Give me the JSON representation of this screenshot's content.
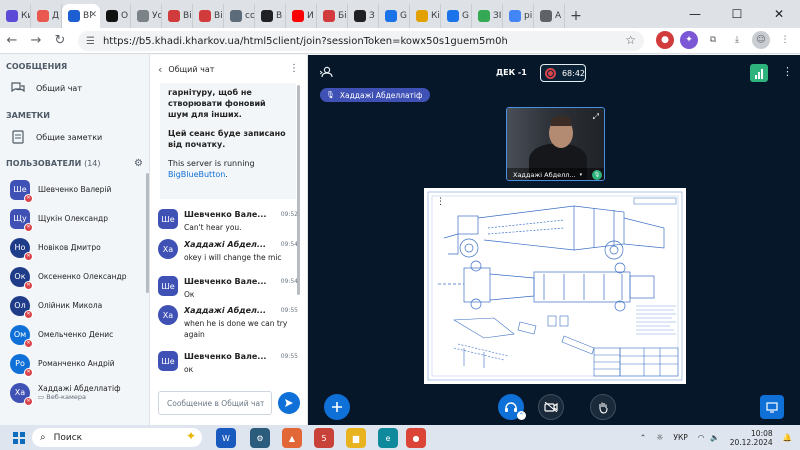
{
  "browser": {
    "tabs": [
      {
        "label": "Ки",
        "color": "#5b4bd6"
      },
      {
        "label": "Д",
        "color": "#e9584f"
      },
      {
        "label": "Bl",
        "color": "#1d5fd0",
        "active": true
      },
      {
        "label": "О",
        "color": "#111111"
      },
      {
        "label": "Ус",
        "color": "#7b8288"
      },
      {
        "label": "Bi",
        "color": "#d23b3b"
      },
      {
        "label": "Bi",
        "color": "#d23b3b"
      },
      {
        "label": "со",
        "color": "#5b6b7a"
      },
      {
        "label": "В",
        "color": "#202124"
      },
      {
        "label": "И",
        "color": "#ff0000"
      },
      {
        "label": "Бі",
        "color": "#d23b3b"
      },
      {
        "label": "З",
        "color": "#202124"
      },
      {
        "label": "G",
        "color": "#1a73e8"
      },
      {
        "label": "Кі",
        "color": "#e3a100"
      },
      {
        "label": "G",
        "color": "#1a73e8"
      },
      {
        "label": "ЗІ",
        "color": "#34a853"
      },
      {
        "label": "pi",
        "color": "#4285f4"
      },
      {
        "label": "А",
        "color": "#5f6368"
      }
    ],
    "url": "https://b5.khadi.kharkov.ua/html5client/join?sessionToken=kowx50s1guem5m0h"
  },
  "sidebar": {
    "messages_title": "СООБЩЕНИЯ",
    "public_chat": "Общий чат",
    "notes_title": "ЗАМЕТКИ",
    "shared_notes": "Общие заметки",
    "users_title": "ПОЛЬЗОВАТЕЛИ",
    "users_count": "(14)",
    "users": [
      {
        "initials": "Ше",
        "name": "Шевченко Валерій",
        "color": "#3f51b5",
        "square": true
      },
      {
        "initials": "Щу",
        "name": "Щукін Олександр",
        "color": "#3f51b5",
        "square": true
      },
      {
        "initials": "Но",
        "name": "Новіков Дмитро",
        "color": "#1f3c88",
        "square": false
      },
      {
        "initials": "Ок",
        "name": "Оксененко Олександр",
        "color": "#1f3c88",
        "square": false
      },
      {
        "initials": "Ол",
        "name": "Олійник Микола",
        "color": "#1f3c88",
        "square": false
      },
      {
        "initials": "Ом",
        "name": "Омельченко Денис",
        "color": "#0f70d7",
        "square": false
      },
      {
        "initials": "Ро",
        "name": "Романченко Андрій",
        "color": "#0f70d7",
        "square": false
      },
      {
        "initials": "Ха",
        "name": "Хаддажі Абделлатіф",
        "color": "#3f51b5",
        "square": false,
        "sub": "Веб-камера"
      }
    ]
  },
  "chat": {
    "title": "Общий чат",
    "welcome_lines": [
      "гарнітуру, щоб не створювати фоновий шум для інших.",
      "Цей сеанс буде записано від початку."
    ],
    "running_text": "This server is running",
    "running_link": "BigBlueButton",
    "running_end": ".",
    "messages": [
      {
        "initials": "Ше",
        "name": "Шевченко Вале...",
        "time": "09:52",
        "text": "Can't hear you.",
        "color": "#3f51b5",
        "square": true,
        "italic": false
      },
      {
        "initials": "Ха",
        "name": "Хаддажі Абдел...",
        "time": "09:54",
        "text": "okey i will change the mic",
        "color": "#3f51b5",
        "square": false,
        "italic": true
      },
      {
        "initials": "Ше",
        "name": "Шевченко Вале...",
        "time": "09:54",
        "text": "Ок",
        "color": "#3f51b5",
        "square": true,
        "italic": false
      },
      {
        "initials": "Ха",
        "name": "Хаддажі Абдел...",
        "time": "09:55",
        "text": "when he is done we can try again",
        "color": "#3f51b5",
        "square": false,
        "italic": true
      },
      {
        "initials": "Ше",
        "name": "Шевченко Вале...",
        "time": "09:55",
        "text": "ок",
        "color": "#3f51b5",
        "square": true,
        "italic": false
      }
    ],
    "input_placeholder": "Сообщение в Общий чат"
  },
  "stage": {
    "meeting_title": "ДЕК -1",
    "recording_time": "68:42",
    "talking_user": "Хаддажі Абделлатіф",
    "webcam_label": "Хаддажі Абделл..."
  },
  "taskbar": {
    "search_placeholder": "Поиск",
    "apps": [
      {
        "name": "word",
        "label": "W",
        "color": "#185abd"
      },
      {
        "name": "settings",
        "label": "⚙",
        "color": "#2c5c7c"
      },
      {
        "name": "matlab",
        "label": "▲",
        "color": "#e16737"
      },
      {
        "name": "red-app",
        "label": "5",
        "color": "#c9423a"
      },
      {
        "name": "file-explorer",
        "label": "▆",
        "color": "#e9b21f"
      },
      {
        "name": "edge",
        "label": "e",
        "color": "#0f8a9d"
      },
      {
        "name": "chrome",
        "label": "●",
        "color": "#db4437"
      }
    ],
    "language": "УКР",
    "time": "10:08",
    "date": "20.12.2024"
  }
}
